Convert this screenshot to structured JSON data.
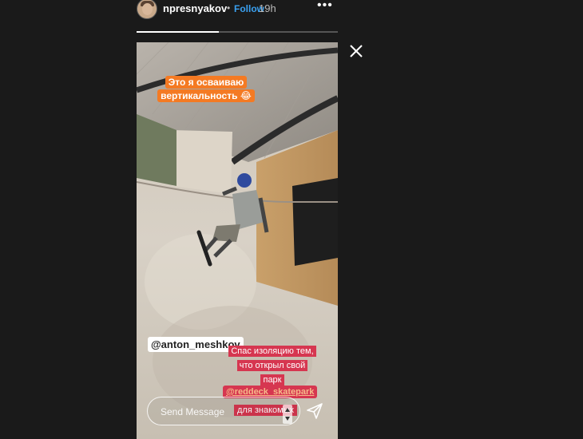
{
  "header": {
    "username": "npresnyakov",
    "separator": "•",
    "follow_label": "Follow",
    "time": "19h",
    "more_label": "•••"
  },
  "story": {
    "progress": 0.41,
    "caption_orange": [
      "Это я осваиваю",
      "вертикальность 😂"
    ],
    "mention_user": "@anton_meshkov",
    "caption_red": [
      "Спас изоляцию тем,",
      "что открыл свой",
      "парк"
    ],
    "mention_park": "@reddeck_skatepark",
    "caption_red_tail": "для знакомых"
  },
  "reply": {
    "placeholder": "Send Message"
  },
  "icons": {
    "close": "close-icon",
    "share": "paper-plane-icon",
    "more": "more-icon"
  },
  "colors": {
    "follow": "#3aa0f0",
    "sticker_orange": "#f47a23",
    "sticker_red": "#d63650",
    "mention_link": "#f6b98a"
  }
}
